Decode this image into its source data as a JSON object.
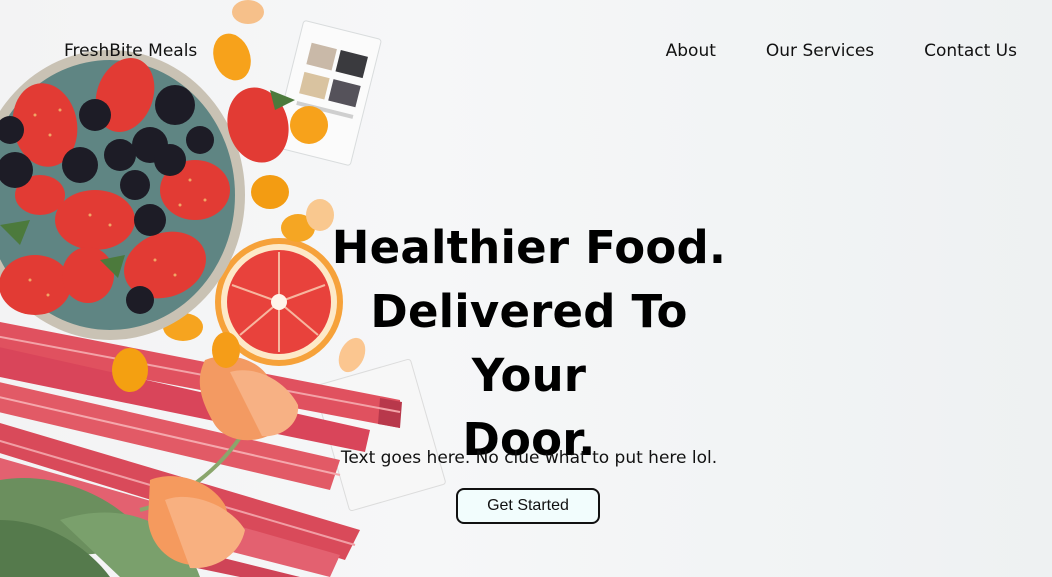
{
  "nav": {
    "brand": "FreshBite Meals",
    "links": [
      {
        "label": "About"
      },
      {
        "label": "Our Services"
      },
      {
        "label": "Contact Us"
      }
    ]
  },
  "hero": {
    "headline_lines": [
      "Healthier Food.",
      "Delivered To Your",
      "Door."
    ],
    "subtext": "Text goes here. No clue what to put here lol.",
    "cta_label": "Get Started"
  },
  "background_image": {
    "subject": "fruit-and-rhubarb-flatlay",
    "items": [
      "bowl-of-strawberries-and-blackberries",
      "blood-orange-half",
      "kumquats",
      "rhubarb-stalks",
      "orange-tulip",
      "recipe-cards"
    ]
  },
  "colors": {
    "background": "#f4f5f6",
    "text": "#111111",
    "button_bg": "#f2fdfd",
    "button_border": "#111111"
  }
}
